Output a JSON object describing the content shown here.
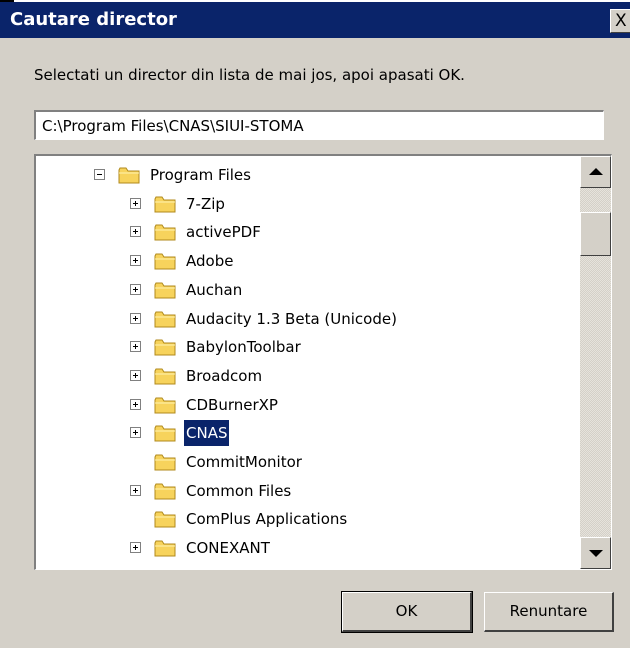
{
  "dialog": {
    "title": "Cautare director",
    "close_label": "X",
    "instructions": "Selectati un director din lista de mai jos, apoi apasati OK.",
    "path_value": "C:\\Program Files\\CNAS\\SIUI-STOMA",
    "ok_label": "OK",
    "cancel_label": "Renuntare"
  },
  "tree": {
    "items": [
      {
        "label": "Program Files",
        "expander": "minus",
        "level": 0
      },
      {
        "label": "7-Zip",
        "expander": "plus",
        "level": 1
      },
      {
        "label": "activePDF",
        "expander": "plus",
        "level": 1
      },
      {
        "label": "Adobe",
        "expander": "plus",
        "level": 1
      },
      {
        "label": "Auchan",
        "expander": "plus",
        "level": 1
      },
      {
        "label": "Audacity 1.3 Beta (Unicode)",
        "expander": "plus",
        "level": 1
      },
      {
        "label": "BabylonToolbar",
        "expander": "plus",
        "level": 1
      },
      {
        "label": "Broadcom",
        "expander": "plus",
        "level": 1
      },
      {
        "label": "CDBurnerXP",
        "expander": "plus",
        "level": 1
      },
      {
        "label": "CNAS",
        "expander": "plus",
        "level": 1,
        "selected": true
      },
      {
        "label": "CommitMonitor",
        "expander": "none",
        "level": 1
      },
      {
        "label": "Common Files",
        "expander": "plus",
        "level": 1
      },
      {
        "label": "ComPlus Applications",
        "expander": "none",
        "level": 1
      },
      {
        "label": "CONEXANT",
        "expander": "plus",
        "level": 1
      }
    ]
  },
  "icons": {
    "folder": "folder-icon",
    "expand": "plus-icon",
    "collapse": "minus-icon",
    "scroll_up": "arrow-up-icon",
    "scroll_down": "arrow-down-icon"
  },
  "colors": {
    "title_bar": "#0a246a",
    "selection": "#0a246a",
    "face": "#d4d0c8",
    "folder_fill": "#f7d35c"
  }
}
